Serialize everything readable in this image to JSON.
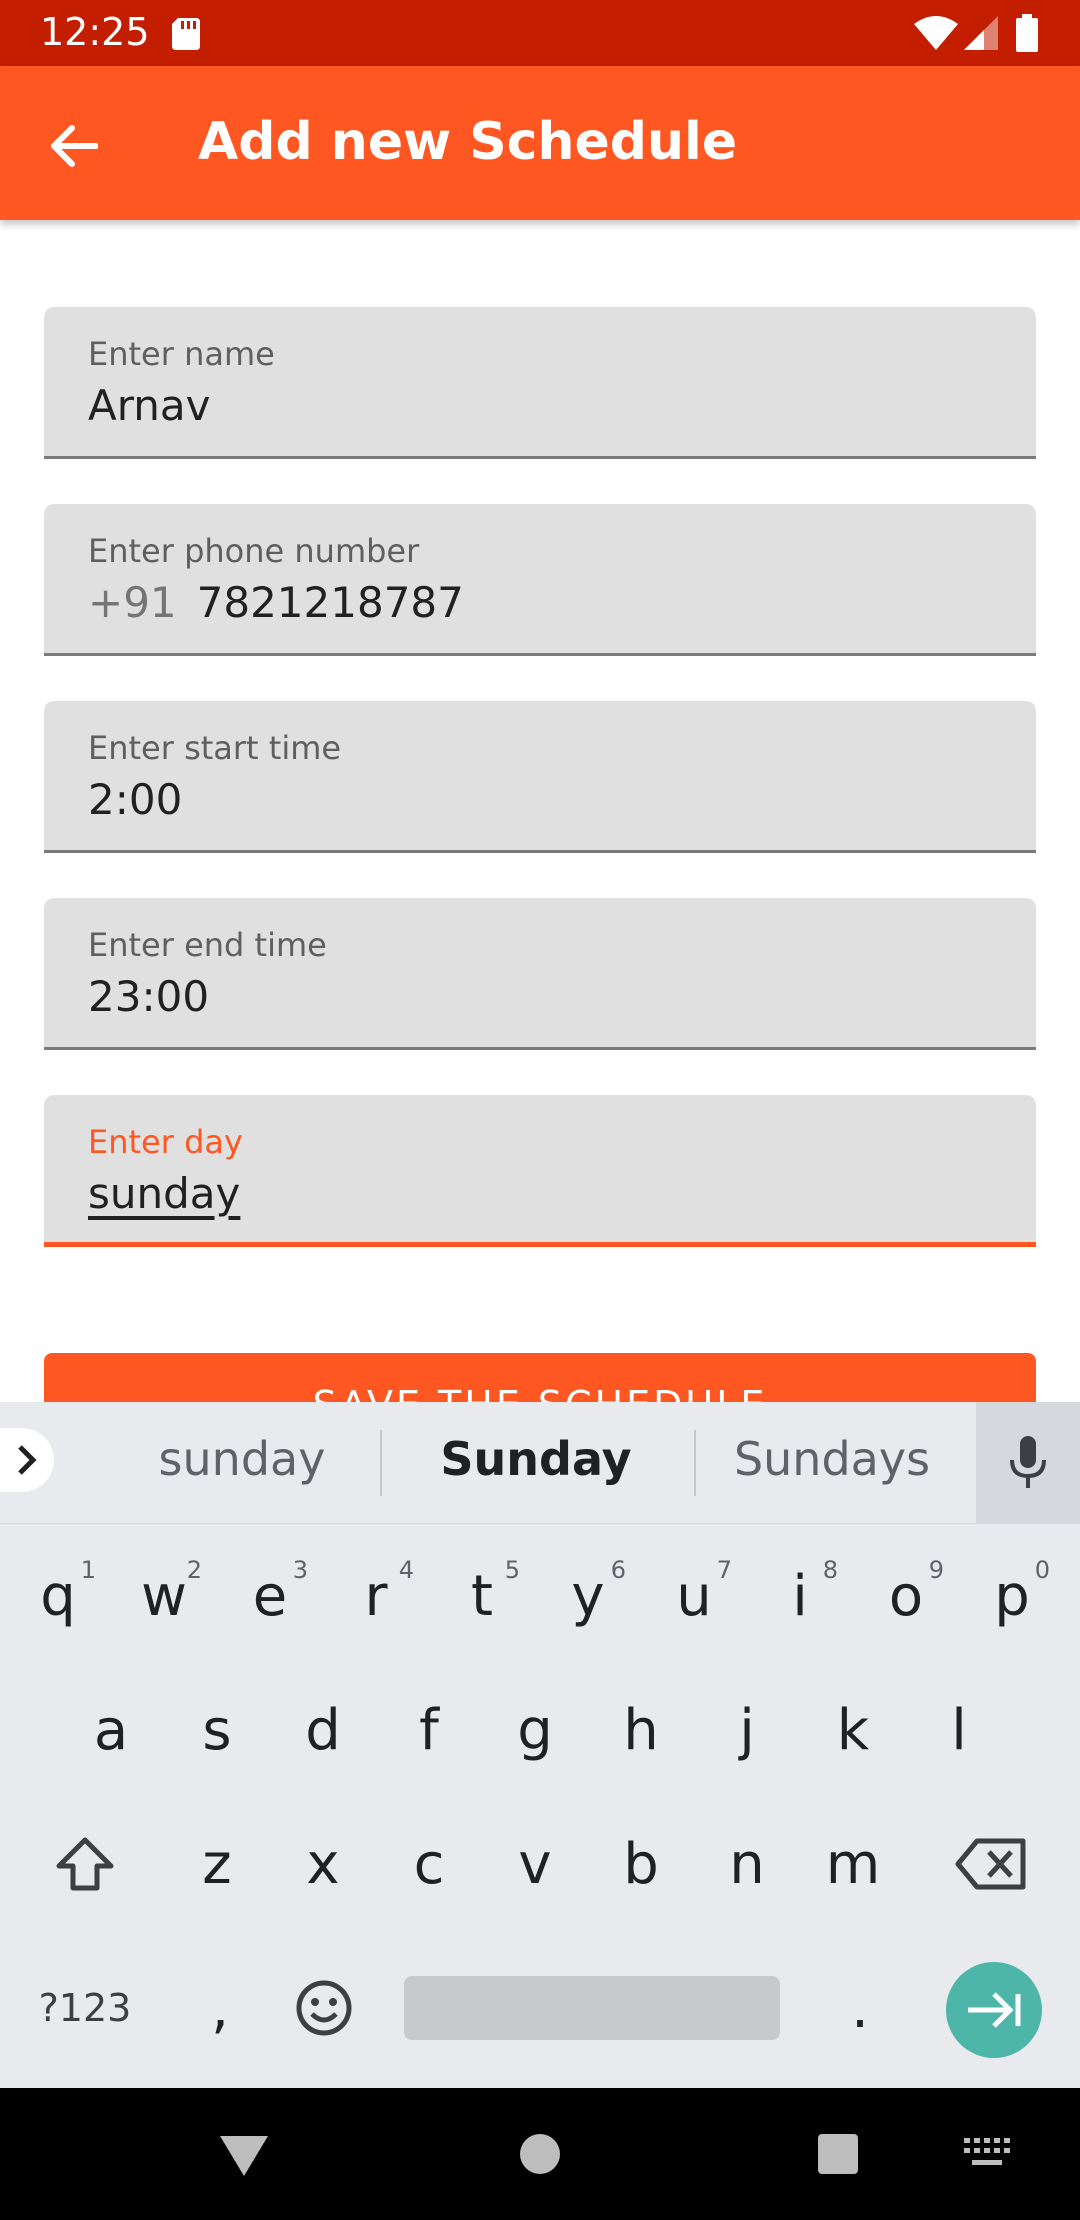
{
  "status_bar": {
    "time": "12:25"
  },
  "app_bar": {
    "title": "Add new Schedule"
  },
  "form": {
    "name": {
      "label": "Enter name",
      "value": "Arnav"
    },
    "phone": {
      "label": "Enter phone number",
      "prefix": "+91",
      "value": "7821218787"
    },
    "start_time": {
      "label": "Enter start time",
      "value": "2:00"
    },
    "end_time": {
      "label": "Enter end time",
      "value": "23:00"
    },
    "day": {
      "label": "Enter day",
      "value": "sunday"
    },
    "save_label": "SAVE THE SCHEDULE"
  },
  "keyboard": {
    "suggestions": [
      "sunday",
      "Sunday",
      "Sundays"
    ],
    "row1": [
      {
        "key": "q",
        "hint": "1"
      },
      {
        "key": "w",
        "hint": "2"
      },
      {
        "key": "e",
        "hint": "3"
      },
      {
        "key": "r",
        "hint": "4"
      },
      {
        "key": "t",
        "hint": "5"
      },
      {
        "key": "y",
        "hint": "6"
      },
      {
        "key": "u",
        "hint": "7"
      },
      {
        "key": "i",
        "hint": "8"
      },
      {
        "key": "o",
        "hint": "9"
      },
      {
        "key": "p",
        "hint": "0"
      }
    ],
    "row2": [
      "a",
      "s",
      "d",
      "f",
      "g",
      "h",
      "j",
      "k",
      "l"
    ],
    "row3": [
      "z",
      "x",
      "c",
      "v",
      "b",
      "n",
      "m"
    ],
    "symbols_label": "?123",
    "comma": ",",
    "period": "."
  },
  "colors": {
    "status_bar": "#c41e00",
    "primary": "#ff5722",
    "field_bg": "#e0e0e0",
    "keyboard_bg": "#e8eaed",
    "enter_key": "#4db6a8"
  }
}
